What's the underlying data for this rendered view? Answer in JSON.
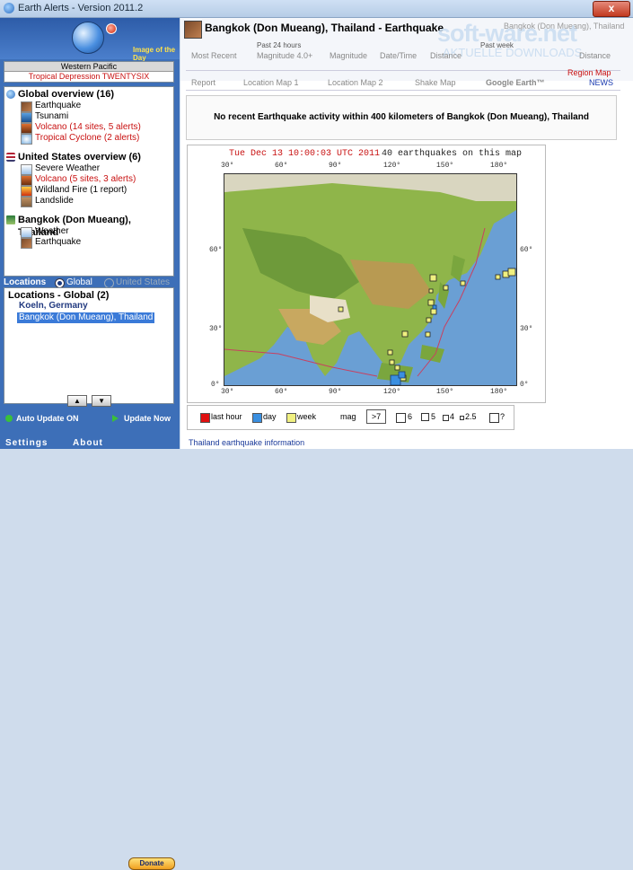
{
  "window": {
    "title": "Earth Alerts - Version 2011.2",
    "close_label": "x"
  },
  "left": {
    "image_of_day": "Image of the Day",
    "region_box": {
      "title": "Western Pacific",
      "subtitle": "Tropical Depression TWENTYSIX"
    },
    "groups": [
      {
        "name": "Global overview (16)",
        "items": [
          {
            "label": "Earthquake",
            "alert": false
          },
          {
            "label": "Tsunami",
            "alert": false
          },
          {
            "label": "Volcano (14 sites, 5 alerts)",
            "alert": true
          },
          {
            "label": "Tropical Cyclone (2 alerts)",
            "alert": true
          }
        ]
      },
      {
        "name": "United States overview (6)",
        "items": [
          {
            "label": "Severe Weather",
            "alert": false
          },
          {
            "label": "Volcano (5 sites, 3 alerts)",
            "alert": true
          },
          {
            "label": "Wildland Fire (1 report)",
            "alert": false
          },
          {
            "label": "Landslide",
            "alert": false
          }
        ]
      },
      {
        "name": "Bangkok (Don Mueang), Thailand",
        "items": [
          {
            "label": "Weather",
            "alert": false
          },
          {
            "label": "Earthquake",
            "alert": false
          }
        ]
      }
    ],
    "locations_label": "Locations",
    "radio_global": "Global",
    "radio_us": "United States",
    "locations_header": "Locations - Global (2)",
    "locations": [
      "Koeln, Germany",
      "Bangkok (Don Mueang), Thailand"
    ],
    "up_arrow": "▲",
    "down_arrow": "▼",
    "auto_update": "Auto Update ON",
    "update_now": "Update Now",
    "settings": "Settings",
    "about": "About",
    "donate": "Donate"
  },
  "right": {
    "location_title": "Bangkok (Don Mueang), Thailand - Earthquake",
    "ghost_title": "Bangkok (Don Mueang), Thailand",
    "past_24": "Past 24 hours",
    "past_week": "Past week",
    "tabs_row1": [
      "Most Recent",
      "Magnitude 4.0+",
      "Magnitude",
      "Date/Time",
      "Distance",
      "Distance"
    ],
    "tabs_row2": [
      "Report",
      "Location Map 1",
      "Location Map 2",
      "Shake Map",
      "Google Earth™"
    ],
    "region_map": "Region Map",
    "news": "NEWS",
    "message": "No recent Earthquake activity within 400 kilometers of Bangkok (Don Mueang), Thailand",
    "map": {
      "timestamp": "Tue Dec 13 10:00:03 UTC 2011",
      "count": "40 earthquakes on this map",
      "lon_ticks": [
        "30°",
        "60°",
        "90°",
        "120°",
        "150°",
        "180°"
      ],
      "lat_ticks": [
        "60°",
        "30°",
        "0°"
      ]
    },
    "legend": {
      "last_hour": "last hour",
      "day": "day",
      "week": "week",
      "mag": "mag",
      "gt7": ">7",
      "m6": "6",
      "m5": "5",
      "m4": "4",
      "m25": "2.5",
      "q": "?"
    },
    "legend_colors": {
      "last_hour": "#e01010",
      "day": "#3a8fe0",
      "week": "#f0f080"
    },
    "footer_link": "Thailand earthquake information",
    "watermark": "soft-ware.net",
    "watermark_sub": "AKTUELLE DOWNLOADS"
  }
}
